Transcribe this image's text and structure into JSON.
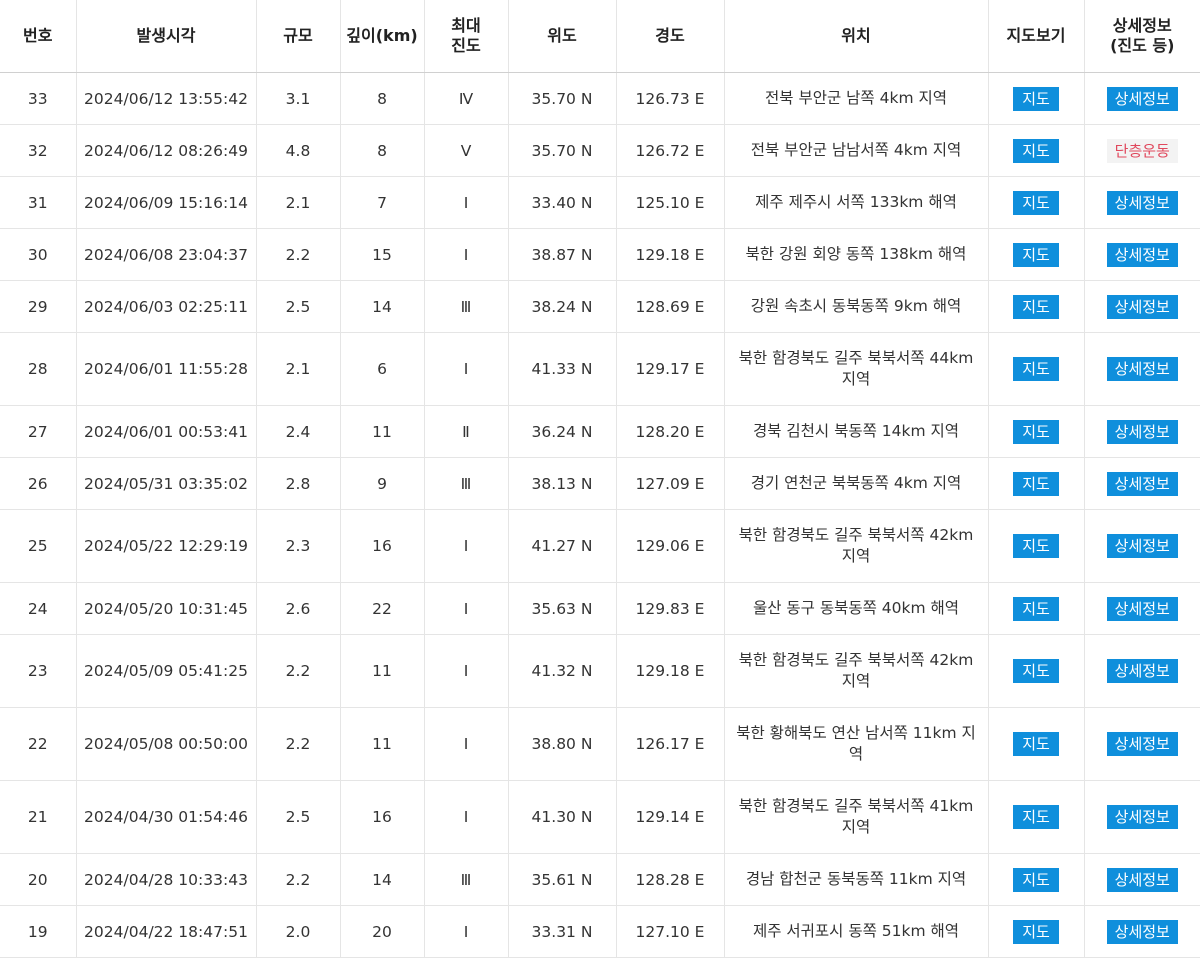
{
  "headers": {
    "no": "번호",
    "time": "발생시각",
    "magnitude": "규모",
    "depth": "깊이(km)",
    "intensity_line1": "최대",
    "intensity_line2": "진도",
    "lat": "위도",
    "lon": "경도",
    "location": "위치",
    "map": "지도보기",
    "detail_line1": "상세정보",
    "detail_line2": "(진도 등)"
  },
  "rows": [
    {
      "no": "33",
      "time": "2024/06/12 13:55:42",
      "mag": "3.1",
      "depth": "8",
      "intensity": "Ⅳ",
      "lat": "35.70 N",
      "lon": "126.73 E",
      "loc": "전북 부안군 남쪽 4km 지역",
      "map": "지도",
      "detail": "상세정보"
    },
    {
      "no": "32",
      "time": "2024/06/12 08:26:49",
      "mag": "4.8",
      "depth": "8",
      "intensity": "Ⅴ",
      "lat": "35.70 N",
      "lon": "126.72 E",
      "loc": "전북 부안군 남남서쪽 4km 지역",
      "map": "지도",
      "detail": "단층운동"
    },
    {
      "no": "31",
      "time": "2024/06/09 15:16:14",
      "mag": "2.1",
      "depth": "7",
      "intensity": "Ⅰ",
      "lat": "33.40 N",
      "lon": "125.10 E",
      "loc": "제주 제주시 서쪽 133km 해역",
      "map": "지도",
      "detail": "상세정보"
    },
    {
      "no": "30",
      "time": "2024/06/08 23:04:37",
      "mag": "2.2",
      "depth": "15",
      "intensity": "Ⅰ",
      "lat": "38.87 N",
      "lon": "129.18 E",
      "loc": "북한 강원 회양 동쪽 138km 해역",
      "map": "지도",
      "detail": "상세정보"
    },
    {
      "no": "29",
      "time": "2024/06/03 02:25:11",
      "mag": "2.5",
      "depth": "14",
      "intensity": "Ⅲ",
      "lat": "38.24 N",
      "lon": "128.69 E",
      "loc": "강원 속초시 동북동쪽 9km 해역",
      "map": "지도",
      "detail": "상세정보"
    },
    {
      "no": "28",
      "time": "2024/06/01 11:55:28",
      "mag": "2.1",
      "depth": "6",
      "intensity": "Ⅰ",
      "lat": "41.33 N",
      "lon": "129.17 E",
      "loc": "북한 함경북도 길주 북북서쪽 44km 지역",
      "map": "지도",
      "detail": "상세정보"
    },
    {
      "no": "27",
      "time": "2024/06/01 00:53:41",
      "mag": "2.4",
      "depth": "11",
      "intensity": "Ⅱ",
      "lat": "36.24 N",
      "lon": "128.20 E",
      "loc": "경북 김천시 북동쪽 14km 지역",
      "map": "지도",
      "detail": "상세정보"
    },
    {
      "no": "26",
      "time": "2024/05/31 03:35:02",
      "mag": "2.8",
      "depth": "9",
      "intensity": "Ⅲ",
      "lat": "38.13 N",
      "lon": "127.09 E",
      "loc": "경기 연천군 북북동쪽 4km 지역",
      "map": "지도",
      "detail": "상세정보"
    },
    {
      "no": "25",
      "time": "2024/05/22 12:29:19",
      "mag": "2.3",
      "depth": "16",
      "intensity": "Ⅰ",
      "lat": "41.27 N",
      "lon": "129.06 E",
      "loc": "북한 함경북도 길주 북북서쪽 42km 지역",
      "map": "지도",
      "detail": "상세정보"
    },
    {
      "no": "24",
      "time": "2024/05/20 10:31:45",
      "mag": "2.6",
      "depth": "22",
      "intensity": "Ⅰ",
      "lat": "35.63 N",
      "lon": "129.83 E",
      "loc": "울산 동구 동북동쪽 40km 해역",
      "map": "지도",
      "detail": "상세정보"
    },
    {
      "no": "23",
      "time": "2024/05/09 05:41:25",
      "mag": "2.2",
      "depth": "11",
      "intensity": "Ⅰ",
      "lat": "41.32 N",
      "lon": "129.18 E",
      "loc": "북한 함경북도 길주 북북서쪽 42km 지역",
      "map": "지도",
      "detail": "상세정보"
    },
    {
      "no": "22",
      "time": "2024/05/08 00:50:00",
      "mag": "2.2",
      "depth": "11",
      "intensity": "Ⅰ",
      "lat": "38.80 N",
      "lon": "126.17 E",
      "loc": "북한 황해북도 연산 남서쪽 11km 지역",
      "map": "지도",
      "detail": "상세정보"
    },
    {
      "no": "21",
      "time": "2024/04/30 01:54:46",
      "mag": "2.5",
      "depth": "16",
      "intensity": "Ⅰ",
      "lat": "41.30 N",
      "lon": "129.14 E",
      "loc": "북한 함경북도 길주 북북서쪽 41km 지역",
      "map": "지도",
      "detail": "상세정보"
    },
    {
      "no": "20",
      "time": "2024/04/28 10:33:43",
      "mag": "2.2",
      "depth": "14",
      "intensity": "Ⅲ",
      "lat": "35.61 N",
      "lon": "128.28 E",
      "loc": "경남 합천군 동북동쪽 11km 지역",
      "map": "지도",
      "detail": "상세정보"
    },
    {
      "no": "19",
      "time": "2024/04/22 18:47:51",
      "mag": "2.0",
      "depth": "20",
      "intensity": "Ⅰ",
      "lat": "33.31 N",
      "lon": "127.10 E",
      "loc": "제주 서귀포시 동쪽 51km 해역",
      "map": "지도",
      "detail": "상세정보"
    }
  ],
  "colors": {
    "button_blue": "#0f8fdc",
    "fault_text": "#e0485d",
    "border": "#e5e5e5"
  }
}
